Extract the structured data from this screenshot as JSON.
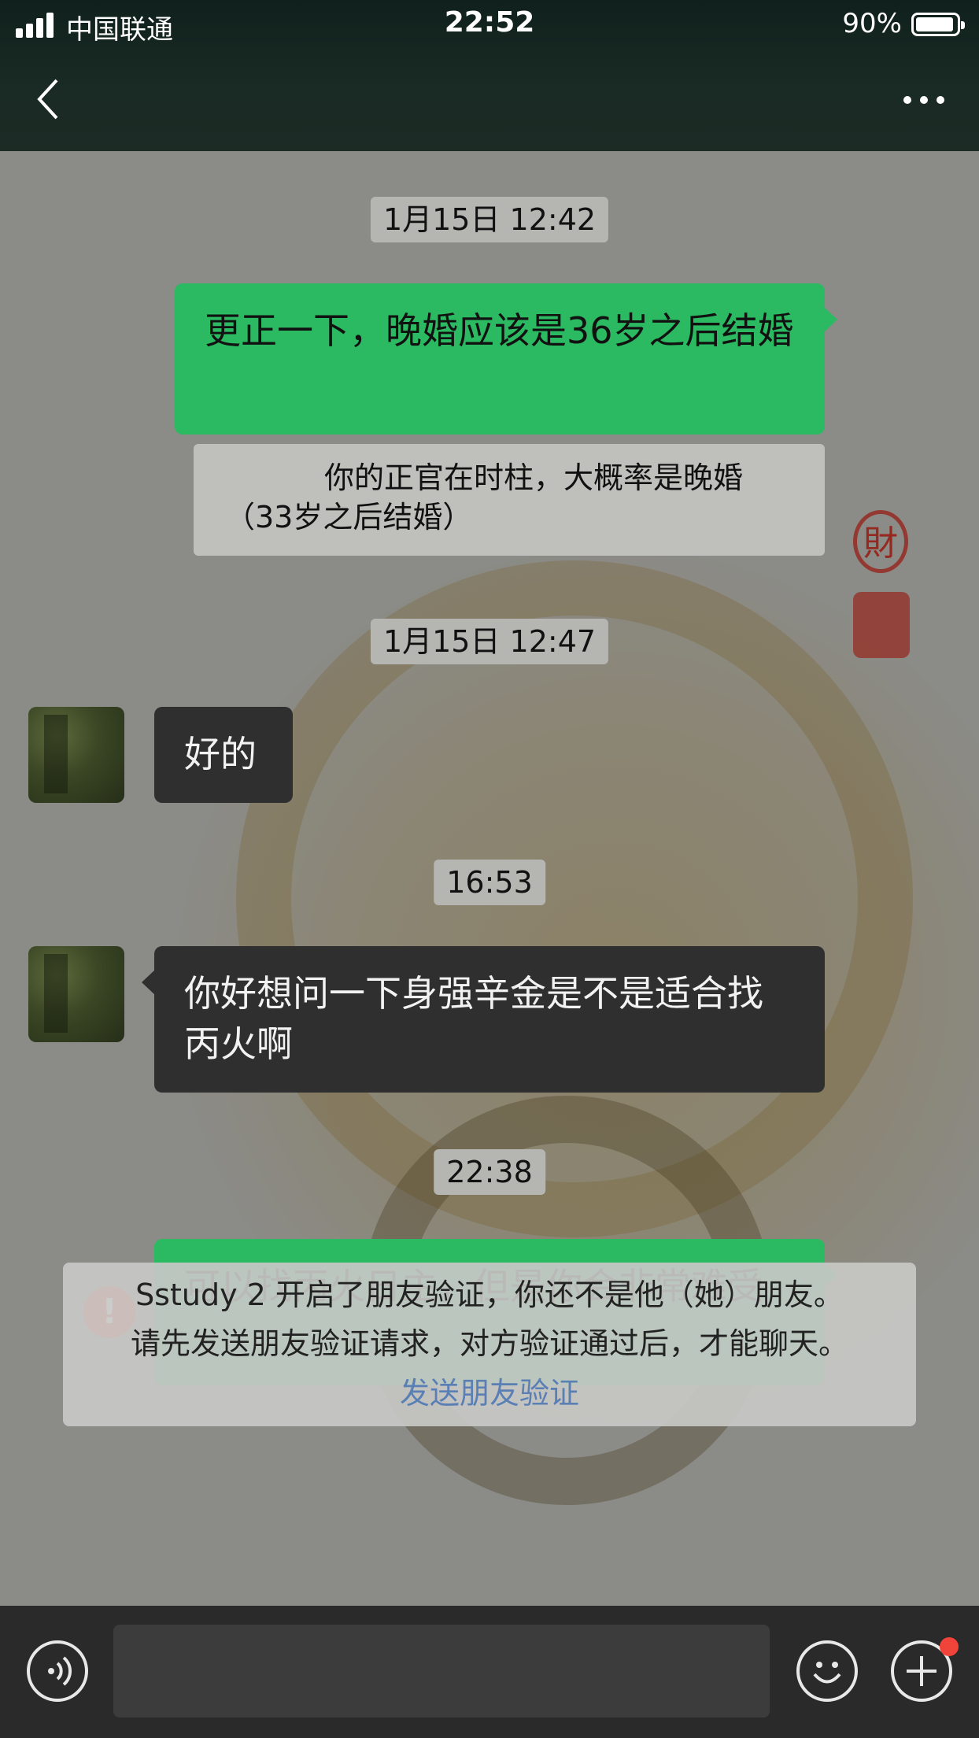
{
  "status_bar": {
    "carrier": "中国联通",
    "time": "22:52",
    "battery": "90%",
    "battery_level": 0.9
  },
  "nav": {
    "back_icon": "chevron-left-icon",
    "more_icon": "ellipsis-icon"
  },
  "messages": [
    {
      "type": "timestamp",
      "text": "1月15日 12:42"
    },
    {
      "type": "outgoing",
      "text": "更正一下，晚婚应该是36岁之后结婚"
    },
    {
      "type": "quote",
      "line1": "你的正官在时柱，大概率是晚婚",
      "line2": "（33岁之后结婚）"
    },
    {
      "type": "timestamp",
      "text": "1月15日 12:47"
    },
    {
      "type": "incoming",
      "text": "好的"
    },
    {
      "type": "timestamp",
      "text": "16:53"
    },
    {
      "type": "incoming",
      "text": "你好想问一下身强辛金是不是适合找丙火啊"
    },
    {
      "type": "timestamp",
      "text": "22:38"
    },
    {
      "type": "outgoing",
      "text": "可以找丙火日主，但是你会非常难受",
      "failed": true,
      "error_mark": "!"
    }
  ],
  "notice": {
    "line1": "Sstudy 2 开启了朋友验证，你还不是他（她）朋友。",
    "line2": "请先发送朋友验证请求，对方验证通过后，才能聊天。",
    "link": "发送朋友验证"
  },
  "background": {
    "seal_char": "財"
  },
  "input_bar": {
    "voice_icon": "voice-icon",
    "emoji_icon": "emoji-icon",
    "plus_icon": "plus-icon"
  },
  "colors": {
    "outgoing_bubble": "#2bba62",
    "incoming_bubble": "#2f2f2f",
    "error": "#f0433a",
    "link": "#5a7fb4"
  }
}
